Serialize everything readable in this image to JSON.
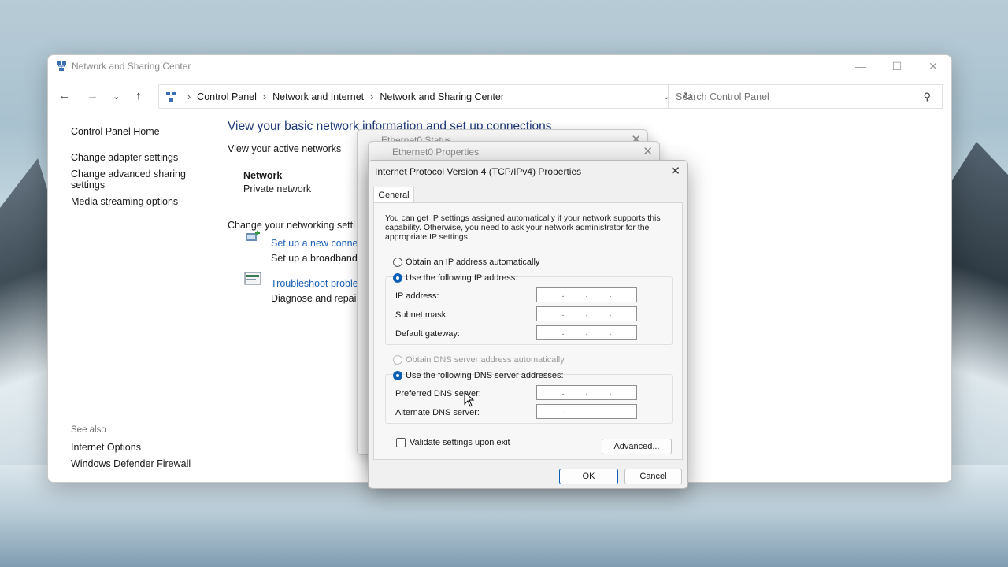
{
  "main_window": {
    "title": "Network and Sharing Center",
    "breadcrumb": [
      "Control Panel",
      "Network and Internet",
      "Network and Sharing Center"
    ],
    "search_placeholder": "Search Control Panel",
    "sidebar": {
      "home": "Control Panel Home",
      "items": [
        "Change adapter settings",
        "Change advanced sharing settings",
        "Media streaming options"
      ],
      "see_also_heading": "See also",
      "see_also": [
        "Internet Options",
        "Windows Defender Firewall"
      ]
    },
    "content": {
      "title": "View your basic network information and set up connections",
      "active_networks": "View your active networks",
      "network_name": "Network",
      "network_type": "Private network",
      "change_settings": "Change your networking setti",
      "setup_link": "Set up a new connec",
      "setup_desc": "Set up a broadband,",
      "troubleshoot_link": "Troubleshoot proble",
      "troubleshoot_desc": "Diagnose and repair"
    }
  },
  "status_dialog": {
    "title": "Ethernet0 Status"
  },
  "properties_dialog": {
    "title": "Ethernet0 Properties"
  },
  "ipv4_dialog": {
    "title": "Internet Protocol Version 4 (TCP/IPv4) Properties",
    "tab": "General",
    "description": "You can get IP settings assigned automatically if your network supports this capability. Otherwise, you need to ask your network administrator for the appropriate IP settings.",
    "ip_auto": "Obtain an IP address automatically",
    "ip_manual": "Use the following IP address:",
    "ip_address_label": "IP address:",
    "subnet_label": "Subnet mask:",
    "gateway_label": "Default gateway:",
    "dns_auto": "Obtain DNS server address automatically",
    "dns_manual": "Use the following DNS server addresses:",
    "preferred_dns_label": "Preferred DNS server:",
    "alternate_dns_label": "Alternate DNS server:",
    "validate_label": "Validate settings upon exit",
    "advanced_button": "Advanced...",
    "ok_button": "OK",
    "cancel_button": "Cancel"
  }
}
